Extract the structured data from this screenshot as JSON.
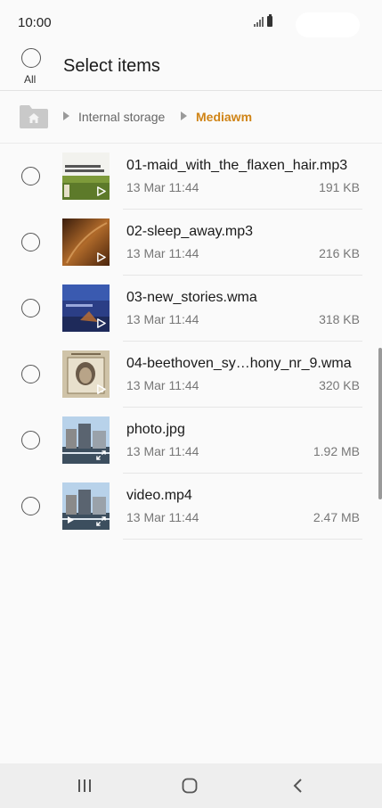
{
  "status_bar": {
    "time": "10:00",
    "icons": [
      "signal-icon",
      "battery-icon"
    ]
  },
  "header": {
    "select_all_label": "All",
    "title": "Select items"
  },
  "breadcrumb": {
    "home_icon": "home-folder-icon",
    "items": [
      "Internal storage",
      "Mediawm"
    ]
  },
  "files": [
    {
      "name": "01-maid_with_the_flaxen_hair.mp3",
      "date": "13 Mar 11:44",
      "size": "191 KB",
      "badge": "play-icon"
    },
    {
      "name": "02-sleep_away.mp3",
      "date": "13 Mar 11:44",
      "size": "216 KB",
      "badge": "play-icon"
    },
    {
      "name": "03-new_stories.wma",
      "date": "13 Mar 11:44",
      "size": "318 KB",
      "badge": "play-icon"
    },
    {
      "name": "04-beethoven_sy…hony_nr_9.wma",
      "date": "13 Mar 11:44",
      "size": "320 KB",
      "badge": "play-icon"
    },
    {
      "name": "photo.jpg",
      "date": "13 Mar 11:44",
      "size": "1.92 MB",
      "badge": "expand-icon"
    },
    {
      "name": "video.mp4",
      "date": "13 Mar 11:44",
      "size": "2.47 MB",
      "badge": "expand-icon"
    }
  ],
  "nav_bar": {
    "recents": "recents-icon",
    "home": "home-icon",
    "back": "back-icon"
  },
  "colors": {
    "accent": "#d08416",
    "text_primary": "#1a1a1a",
    "text_secondary": "#777777"
  }
}
